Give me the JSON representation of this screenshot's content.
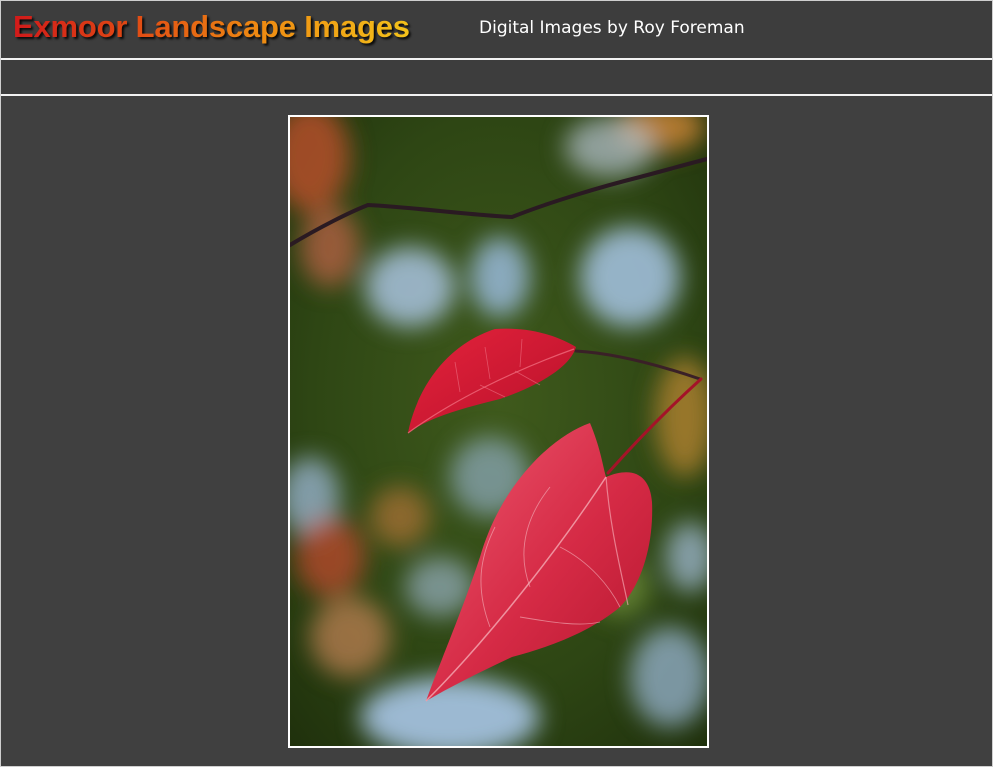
{
  "header": {
    "title": "Exmoor Landscape Images",
    "subtitle": "Digital Images by Roy Foreman"
  },
  "photo": {
    "subject": "red-autumn-leaves-photo"
  },
  "colors": {
    "page_background": "#404040",
    "divider": "#f2f2f2",
    "title_gradient_start": "#d11a1a",
    "title_gradient_end": "#f3c21a",
    "leaf_red": "#d21c34"
  }
}
